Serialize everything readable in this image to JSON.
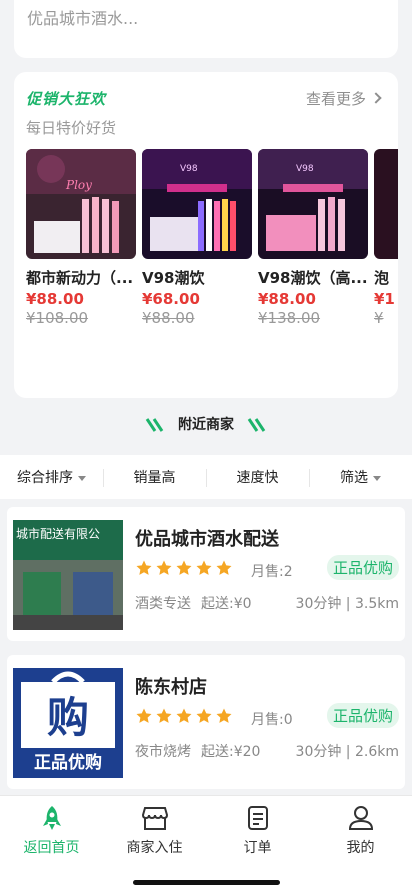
{
  "top": {
    "desc": "优品城市酒水..."
  },
  "promo": {
    "title": "促销大狂欢",
    "more": "查看更多",
    "subtitle": "每日特价好货",
    "products": [
      {
        "name": "都市新动力（...",
        "price": "¥88.00",
        "old_price": "¥108.00"
      },
      {
        "name": "V98潮饮",
        "price": "¥68.00",
        "old_price": "¥88.00"
      },
      {
        "name": "V98潮饮（高...",
        "price": "¥88.00",
        "old_price": "¥138.00"
      },
      {
        "name": "泡",
        "price": "¥1",
        "old_price": "¥"
      }
    ]
  },
  "nearby_title": "附近商家",
  "sort": {
    "comprehensive": "综合排序",
    "sales": "销量高",
    "speed": "速度快",
    "filter": "筛选"
  },
  "shops": [
    {
      "name": "优品城市酒水配送",
      "sales": "月售:2",
      "badge": "正品优购",
      "category": "酒类专送",
      "min_order": "起送:¥0",
      "distance": "30分钟 | 3.5km",
      "rating": 5
    },
    {
      "name": "陈东村店",
      "sales": "月售:0",
      "badge": "正品优购",
      "category": "夜市烧烤",
      "min_order": "起送:¥20",
      "distance": "30分钟 | 2.6km",
      "rating": 5
    }
  ],
  "shop_images": {
    "shop1_sign": "城市配送有限公",
    "shop2_big": "购",
    "shop2_small": "正品优购"
  },
  "tabbar": {
    "home": "返回首页",
    "merchant": "商家入住",
    "orders": "订单",
    "mine": "我的"
  },
  "colors": {
    "accent": "#1cb46b",
    "price": "#e53935"
  }
}
